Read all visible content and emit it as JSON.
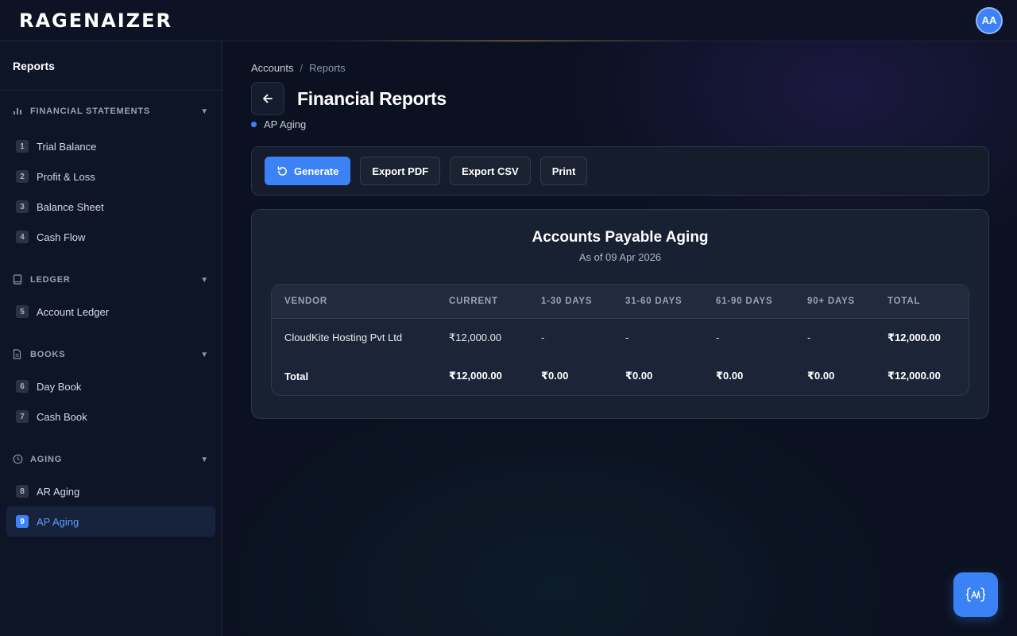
{
  "app": {
    "logo": "RAGENAIZER",
    "avatar_initials": "AA"
  },
  "sidebar": {
    "title": "Reports",
    "sections": [
      {
        "label": "FINANCIAL STATEMENTS",
        "icon": "bar-chart-icon",
        "items": [
          {
            "num": "1",
            "label": "Trial Balance"
          },
          {
            "num": "2",
            "label": "Profit & Loss"
          },
          {
            "num": "3",
            "label": "Balance Sheet"
          },
          {
            "num": "4",
            "label": "Cash Flow"
          }
        ]
      },
      {
        "label": "LEDGER",
        "icon": "book-icon",
        "items": [
          {
            "num": "5",
            "label": "Account Ledger"
          }
        ]
      },
      {
        "label": "BOOKS",
        "icon": "document-icon",
        "items": [
          {
            "num": "6",
            "label": "Day Book"
          },
          {
            "num": "7",
            "label": "Cash Book"
          }
        ]
      },
      {
        "label": "AGING",
        "icon": "clock-icon",
        "items": [
          {
            "num": "8",
            "label": "AR Aging"
          },
          {
            "num": "9",
            "label": "AP Aging",
            "active": true
          }
        ]
      }
    ]
  },
  "breadcrumb": {
    "parent": "Accounts",
    "separator": "/",
    "current": "Reports"
  },
  "page": {
    "title": "Financial Reports",
    "subtitle": "AP Aging"
  },
  "toolbar": {
    "generate_label": "Generate",
    "export_pdf_label": "Export PDF",
    "export_csv_label": "Export CSV",
    "print_label": "Print"
  },
  "report": {
    "title": "Accounts Payable Aging",
    "date": "As of 09 Apr 2026",
    "columns": [
      "VENDOR",
      "CURRENT",
      "1-30 DAYS",
      "31-60 DAYS",
      "61-90 DAYS",
      "90+ DAYS",
      "TOTAL"
    ],
    "rows": [
      [
        "CloudKite Hosting Pvt Ltd",
        "₹12,000.00",
        "-",
        "-",
        "-",
        "-",
        "₹12,000.00"
      ]
    ],
    "total_row": [
      "Total",
      "₹12,000.00",
      "₹0.00",
      "₹0.00",
      "₹0.00",
      "₹0.00",
      "₹12,000.00"
    ]
  },
  "colors": {
    "accent": "#3b82f6",
    "background": "#0b1120",
    "panel": "#182132"
  }
}
